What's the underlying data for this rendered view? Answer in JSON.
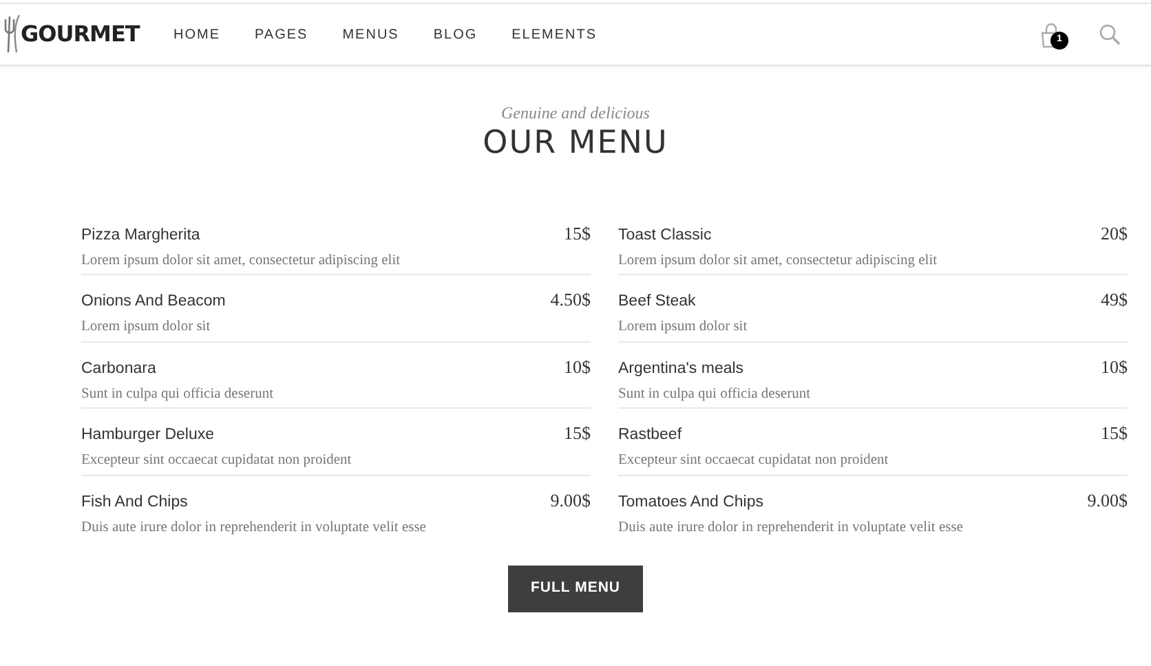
{
  "header": {
    "logo": "GOURMET",
    "nav": [
      {
        "label": "HOME"
      },
      {
        "label": "PAGES"
      },
      {
        "label": "MENUS"
      },
      {
        "label": "BLOG"
      },
      {
        "label": "ELEMENTS"
      }
    ],
    "cart_count": "1"
  },
  "section": {
    "subtitle": "Genuine and delicious",
    "title": "OUR MENU"
  },
  "columns": [
    [
      {
        "name": "Pizza Margherita",
        "price": "15$",
        "description": "Lorem ipsum dolor sit amet, consectetur adipiscing elit"
      },
      {
        "name": "Onions And Beacom",
        "price": "4.50$",
        "description": "Lorem ipsum dolor sit"
      },
      {
        "name": "Carbonara",
        "price": "10$",
        "description": "Sunt in culpa qui officia deserunt"
      },
      {
        "name": "Hamburger Deluxe",
        "price": "15$",
        "description": "Excepteur sint occaecat cupidatat non proident"
      },
      {
        "name": "Fish And Chips",
        "price": "9.00$",
        "description": "Duis aute irure dolor in reprehenderit in voluptate velit esse"
      }
    ],
    [
      {
        "name": "Toast Classic",
        "price": "20$",
        "description": "Lorem ipsum dolor sit amet, consectetur adipiscing elit"
      },
      {
        "name": "Beef Steak",
        "price": "49$",
        "description": "Lorem ipsum dolor sit"
      },
      {
        "name": "Argentina's meals",
        "price": "10$",
        "description": "Sunt in culpa qui officia deserunt"
      },
      {
        "name": "Rastbeef",
        "price": "15$",
        "description": "Excepteur sint occaecat cupidatat non proident"
      },
      {
        "name": "Tomatoes And Chips",
        "price": "9.00$",
        "description": "Duis aute irure dolor in reprehenderit in voluptate velit esse"
      }
    ]
  ],
  "button": "FULL MENU"
}
